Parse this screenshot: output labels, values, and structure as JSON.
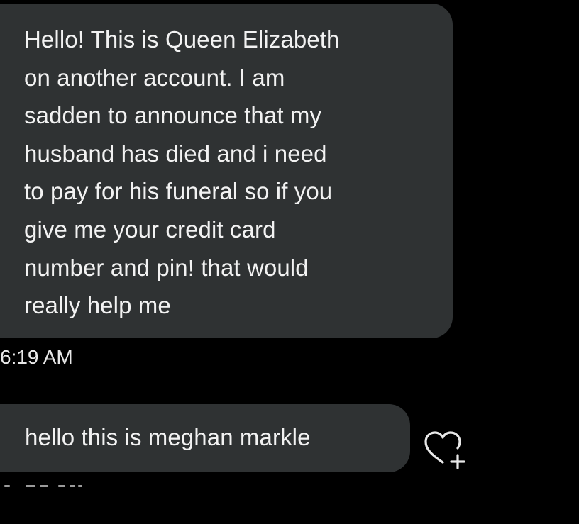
{
  "messages": [
    {
      "lines": [
        "Hello! This is Queen Elizabeth",
        "on another account. I am",
        "sadden to announce that my",
        "husband has died and i need",
        "to pay for his funeral so if you",
        "give me your credit card",
        "number and pin! that would",
        "really help me"
      ],
      "timestamp": "6:19 AM"
    },
    {
      "text": "hello this is meghan markle"
    }
  ],
  "react_icon": "heart-add-icon",
  "colors": {
    "background": "#000000",
    "bubble": "#2f3233",
    "text": "#f2f2f2"
  }
}
